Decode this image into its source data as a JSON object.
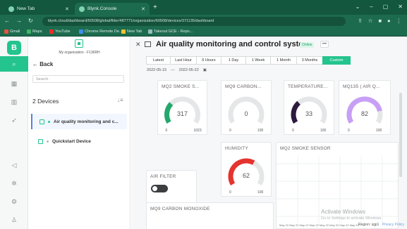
{
  "browser": {
    "tabs": [
      {
        "label": "New Tab"
      },
      {
        "label": "Blynk.Console"
      }
    ],
    "new_tab": "+",
    "window_controls": [
      "⌄",
      "–",
      "▢",
      "✕"
    ],
    "url": "blynk.cloud/dashboard/60508/global/filter/487771/organization/60508/devices/371135/dashboard",
    "bookmarks": [
      "Gmail",
      "Maps",
      "YouTube",
      "Chrome Remote De...",
      "New Tab",
      "Takeout GCE - Repo..."
    ]
  },
  "rail": {
    "logo": "B",
    "items": [
      "search",
      "grid",
      "building",
      "send",
      "megaphone",
      "gear-circle",
      "settings",
      "person"
    ]
  },
  "device_panel": {
    "org_name": "My organization - F136RH",
    "back_label": "Back",
    "search_placeholder": "Search",
    "device_count": "2 Devices",
    "sort_icon": "↓≡",
    "devices": [
      {
        "name": "Air quality monitoring and c...",
        "online": true
      },
      {
        "name": "Quickstart Device",
        "online": false
      }
    ]
  },
  "dashboard": {
    "title": "Air quality monitoring and control system",
    "status": "Online",
    "more": "•••",
    "ranges": [
      "Latest",
      "Last Hour",
      "6 Hours",
      "1 Day",
      "1 Week",
      "1 Month",
      "3 Months",
      "Custom"
    ],
    "active_range": "Custom",
    "date_from": "2022-05-15",
    "date_sep": "—",
    "date_to": "2022-05-22",
    "gauges": [
      {
        "title": "MQ2 SMOKE S...",
        "value": 317,
        "min": 0,
        "max": 1023,
        "color": "#23a86b"
      },
      {
        "title": "MQ9 CARBON...",
        "value": 0,
        "min": 0,
        "max": 100,
        "color": "#23a86b"
      },
      {
        "title": "TEMPERATURE...",
        "value": 33,
        "min": 0,
        "max": 100,
        "color": "#2e1a3f"
      },
      {
        "title": "MQ135 ( AIR Q...",
        "value": 82,
        "min": 0,
        "max": 100,
        "color": "#c79ff5"
      },
      {
        "title": "HUMIDITY",
        "value": 62,
        "min": 0,
        "max": 100,
        "color": "#e5332e"
      }
    ],
    "air_filter": {
      "title": "AIR FILTER",
      "on": false
    },
    "chart_title": "MQ2 SMOKE SENSOR",
    "mq9_title": "MQ9 CARBON MONOXIDE",
    "chart_x_ticks": "May 22 May 22 May 22 May 22 May 22 May 22 May 22 May 22",
    "region": "Region: sgp1",
    "privacy": "Privacy Policy"
  },
  "watermark": {
    "line1": "Activate Windows",
    "line2": "Go to Settings to activate Windows."
  }
}
